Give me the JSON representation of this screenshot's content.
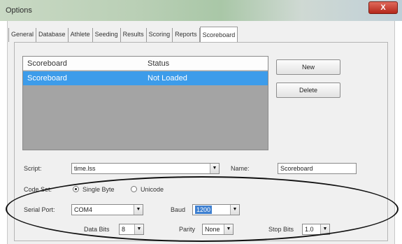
{
  "window": {
    "title": "Options",
    "close_label": "X"
  },
  "tabs": [
    "General",
    "Database",
    "Athlete",
    "Seeding",
    "Results",
    "Scoring",
    "Reports",
    "Scoreboard"
  ],
  "active_tab": "Scoreboard",
  "scoreboard_list": {
    "columns": [
      "Scoreboard",
      "Status"
    ],
    "rows": [
      {
        "scoreboard": "Scoreboard",
        "status": "Not Loaded"
      }
    ]
  },
  "buttons": {
    "new": "New",
    "delete": "Delete"
  },
  "form": {
    "script_label": "Script:",
    "script_value": "time.lss",
    "name_label": "Name:",
    "name_value": "Scoreboard",
    "codeset_label": "Code Set:",
    "codeset_options": [
      "Single Byte",
      "Unicode"
    ],
    "codeset_selected": "Single Byte",
    "serial_port_label": "Serial Port:",
    "serial_port_value": "COM4",
    "baud_label": "Baud",
    "baud_value": "1200",
    "data_bits_label": "Data Bits",
    "data_bits_value": "8",
    "parity_label": "Parity",
    "parity_value": "None",
    "stop_bits_label": "Stop Bits",
    "stop_bits_value": "1.0"
  },
  "colors": {
    "selection": "#3d9cea",
    "list_background": "#a4a4a4",
    "annotation_ellipse": "#111111"
  }
}
